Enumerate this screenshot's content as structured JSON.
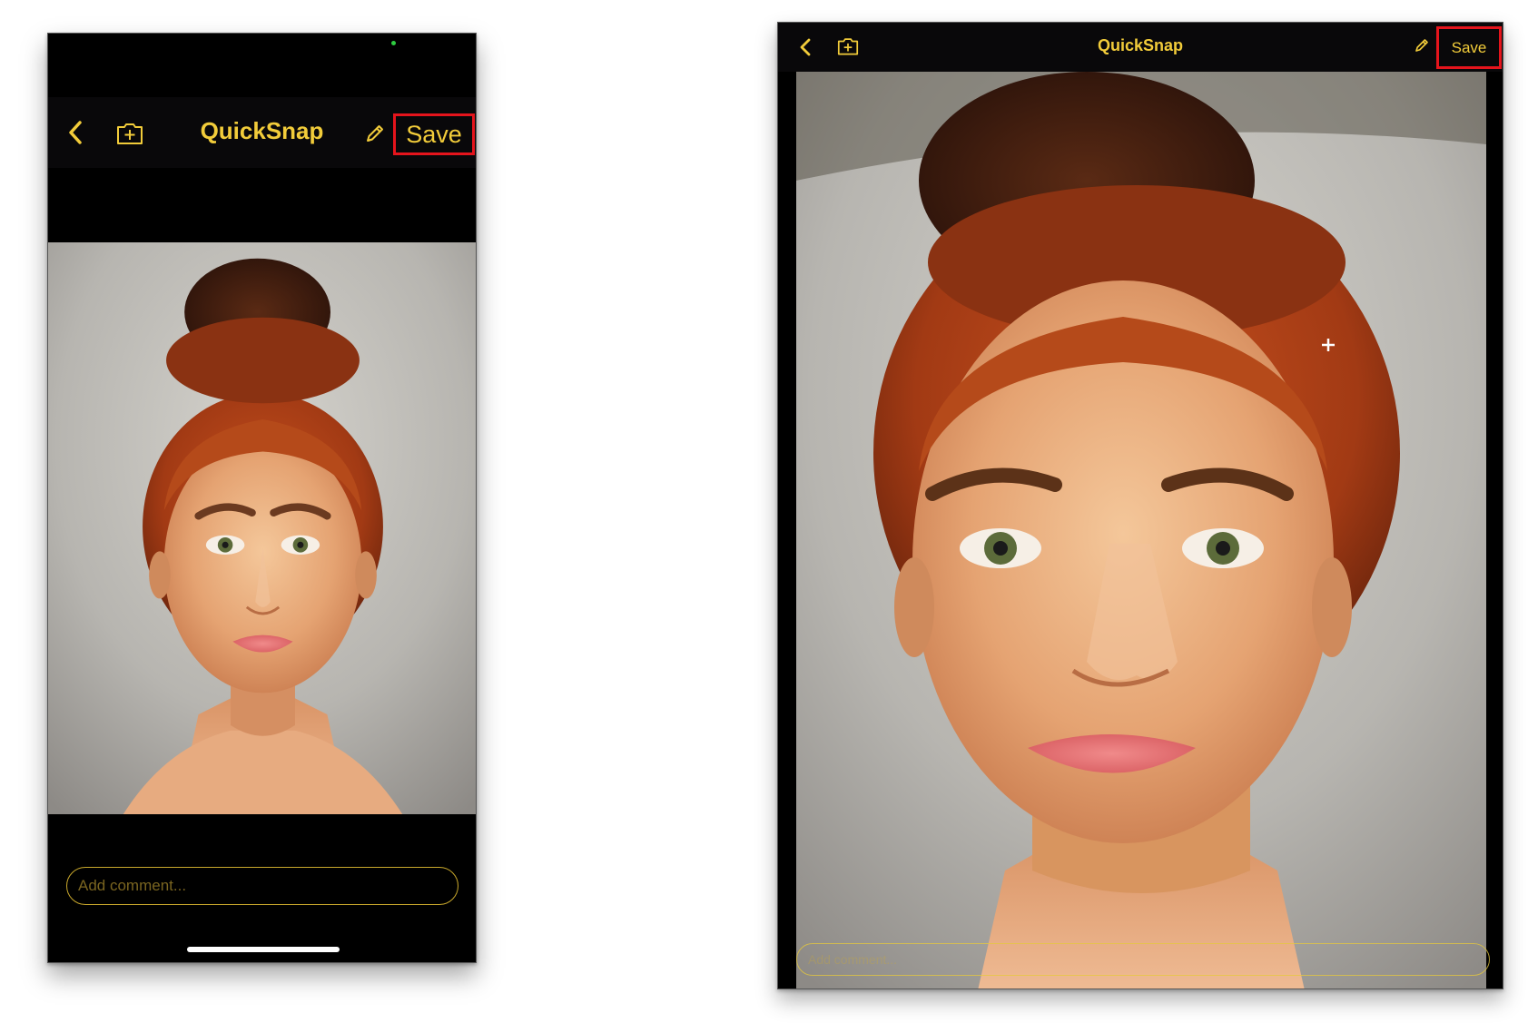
{
  "app": {
    "title": "QuickSnap",
    "save_label": "Save",
    "comment_placeholder": "Add comment..."
  },
  "icons": {
    "back": "chevron-left-icon",
    "add_photo": "add-photo-icon",
    "edit": "pencil-icon"
  },
  "colors": {
    "accent": "#f2cc3a",
    "highlight_box": "#e5141c",
    "background": "#000000"
  }
}
